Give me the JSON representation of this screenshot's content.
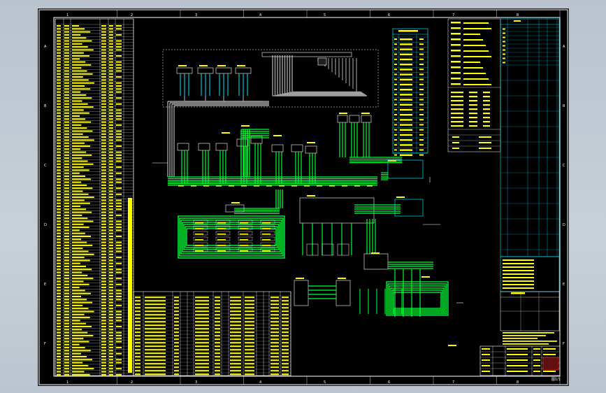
{
  "app": {
    "background": "#c0c9d3",
    "canvas_color": "#000000"
  },
  "drawing": {
    "frame_color": "#ffffff",
    "cable_colors": {
      "primary": "#00ff33",
      "secondary": "#a0a0a0",
      "tertiary": "#00e5ff",
      "text": "#ffff00"
    },
    "grid_columns": [
      "1",
      "2",
      "3",
      "4",
      "5",
      "6",
      "7",
      "8"
    ],
    "grid_rows": [
      "A",
      "B",
      "C",
      "D",
      "E",
      "F"
    ],
    "sheet_label": "图1/1"
  }
}
